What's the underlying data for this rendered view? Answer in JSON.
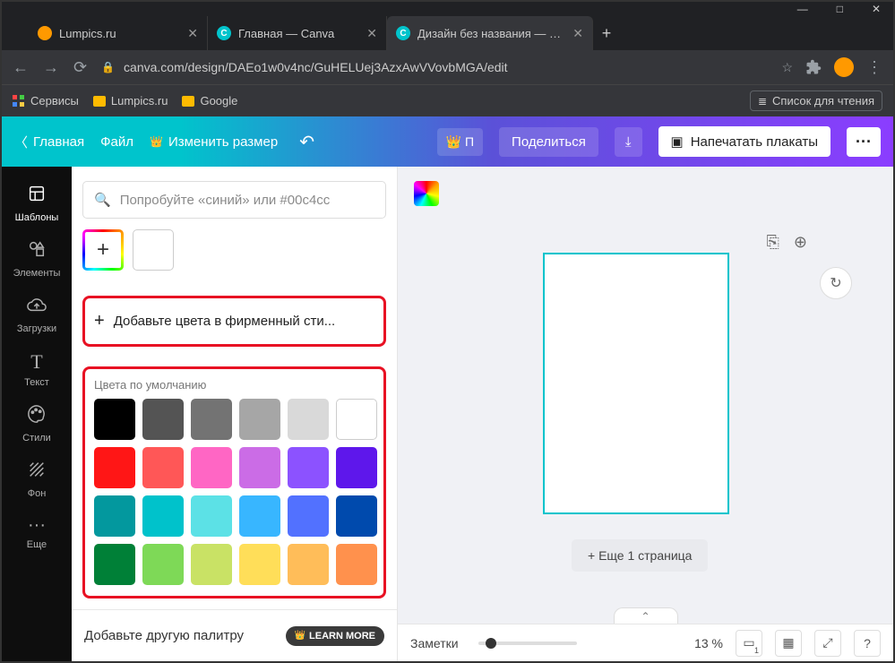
{
  "window": {
    "min": "—",
    "max": "□",
    "close": "✕"
  },
  "tabs": [
    {
      "title": "Lumpics.ru"
    },
    {
      "title": "Главная — Canva"
    },
    {
      "title": "Дизайн без названия — Плака"
    }
  ],
  "tab_add": "+",
  "url": "canva.com/design/DAEo1w0v4nc/GuHELUej3AzxAwVVovbMGA/edit",
  "bookmarks": {
    "services": "Сервисы",
    "lumpics": "Lumpics.ru",
    "google": "Google",
    "reading_list": "Список для чтения"
  },
  "canva_bar": {
    "home": "Главная",
    "file": "Файл",
    "resize": "Изменить размер",
    "pro_short": "П",
    "share": "Поделиться",
    "print": "Напечатать плакаты",
    "more": "···"
  },
  "vnav": {
    "templates": "Шаблоны",
    "elements": "Элементы",
    "uploads": "Загрузки",
    "text": "Текст",
    "styles": "Стили",
    "background": "Фон",
    "more": "Еще"
  },
  "panel": {
    "search_placeholder": "Попробуйте «синий» или #00c4cc",
    "add_brand": "Добавьте цвета в фирменный сти...",
    "defaults_title": "Цвета по умолчанию",
    "another_palette": "Добавьте другую палитру",
    "learn_more": "LEARN MORE"
  },
  "colors": {
    "row1": [
      "#000000",
      "#545454",
      "#737373",
      "#a6a6a6",
      "#d9d9d9",
      "#ffffff"
    ],
    "row2": [
      "#ff1616",
      "#ff5757",
      "#ff66c4",
      "#cb6ce6",
      "#8c52ff",
      "#5e17eb"
    ],
    "row3": [
      "#03989e",
      "#00c2cb",
      "#5ce1e6",
      "#38b6ff",
      "#5271ff",
      "#004aad"
    ],
    "row4": [
      "#008037",
      "#7ed957",
      "#c9e265",
      "#ffde59",
      "#ffbd59",
      "#ff914d"
    ]
  },
  "canvas": {
    "add_page": "+ Еще 1 страница",
    "notes": "Заметки",
    "zoom": "13 %",
    "page_indicator": "1"
  }
}
